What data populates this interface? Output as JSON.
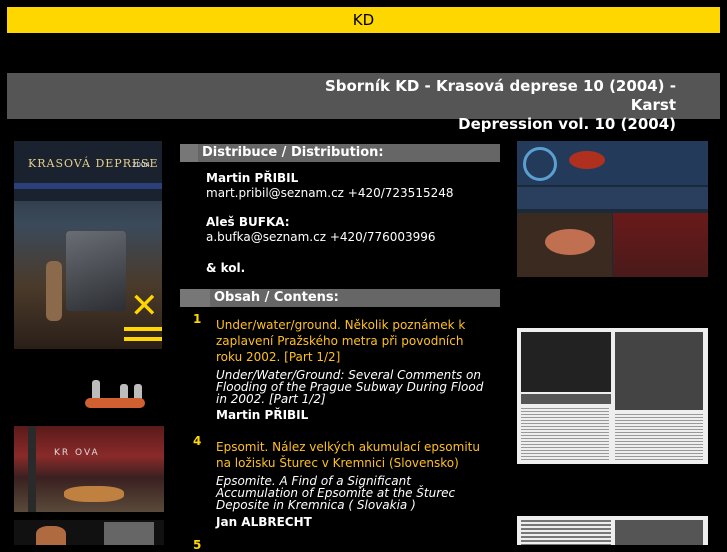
{
  "site": {
    "name": "KD"
  },
  "page": {
    "title_line1": "Sborník KD - Krasová deprese 10 (2004) - Karst",
    "title_line2": "Depression vol. 10 (2004)"
  },
  "cover": {
    "logo_text": "KRASOVÁ DEPRESE",
    "year_text": "2004"
  },
  "thumb": {
    "sign_text": "KR  OVA"
  },
  "distribution": {
    "heading": "Distribuce / Distribution:",
    "contacts": [
      {
        "name": "Martin PŘIBIL",
        "line": "mart.pribil@seznam.cz +420/723515248"
      },
      {
        "name": "Aleš BUFKA",
        "suffix": ":",
        "line": "a.bufka@seznam.cz +420/776003996"
      }
    ],
    "etc": "& kol."
  },
  "contents": {
    "heading": "Obsah / Contens:",
    "articles": [
      {
        "page": "1",
        "title_cz": "Under/water/ground. Několik poznámek k zaplavení Pražského metra při povodních roku 2002. [Part 1/2]",
        "title_en": "Under/Water/Ground: Several Comments on Flooding of the Prague Subway During Flood in 2002. [Part 1/2]",
        "author": "Martin PŘIBIL"
      },
      {
        "page": "4",
        "title_cz": "Epsomit. Nález velkých akumulací epsomitu na ložisku Šturec v Kremnici (Slovensko)",
        "title_en": "Epsomite. A Find of a Significant Accumulation of Epsomite at the Šturec Deposite in Kremnica ( Slovakia )",
        "author": "Jan ALBRECHT"
      }
    ],
    "next_page": "5"
  },
  "colors": {
    "accent": "#ffd700",
    "link": "#ffc020",
    "header_bg": "#555555"
  }
}
